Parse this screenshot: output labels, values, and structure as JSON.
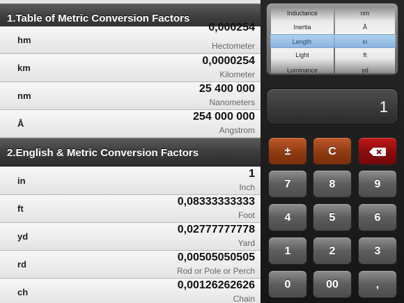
{
  "sections": [
    {
      "title": "1.Table of Metric Conversion Factors",
      "rows": [
        {
          "abbr": "hm",
          "value": "0,000254",
          "name": "Hectometer"
        },
        {
          "abbr": "km",
          "value": "0,0000254",
          "name": "Kilometer"
        },
        {
          "abbr": "nm",
          "value": "25 400 000",
          "name": "Nanometers"
        },
        {
          "abbr": "Å",
          "value": "254 000 000",
          "name": "Angstrom"
        }
      ]
    },
    {
      "title": "2.English & Metric Conversion Factors",
      "rows": [
        {
          "abbr": "in",
          "value": "1",
          "name": "Inch"
        },
        {
          "abbr": "ft",
          "value": "0,08333333333",
          "name": "Foot"
        },
        {
          "abbr": "yd",
          "value": "0,02777777778",
          "name": "Yard"
        },
        {
          "abbr": "rd",
          "value": "0,00505050505",
          "name": "Rod or Pole or Perch"
        },
        {
          "abbr": "ch",
          "value": "0,00126262626",
          "name": "Chain"
        }
      ]
    }
  ],
  "picker": {
    "left": [
      "Inductance",
      "Inertia",
      "Length",
      "Light",
      "Luminance"
    ],
    "right": [
      "nm",
      "Å",
      "in",
      "ft",
      "yd"
    ]
  },
  "display": {
    "value": "1"
  },
  "keypad": {
    "plusminus": "±",
    "clear": "C",
    "k7": "7",
    "k8": "8",
    "k9": "9",
    "k4": "4",
    "k5": "5",
    "k6": "6",
    "k1": "1",
    "k2": "2",
    "k3": "3",
    "k0": "0",
    "k00": "00",
    "comma": ","
  },
  "colors": {
    "function_key": "#8f3a12",
    "backspace_key": "#8a0c0c",
    "picker_selection": "#8fb8e0"
  }
}
